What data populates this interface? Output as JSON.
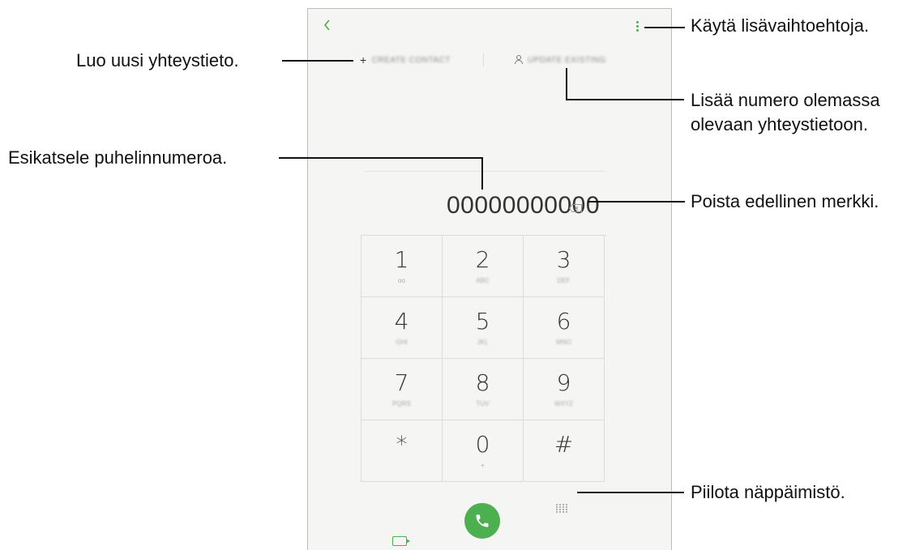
{
  "annotations": {
    "more_options": "Käytä lisävaihtoehtoja.",
    "create_contact": "Luo uusi yhteystieto.",
    "add_to_existing_1": "Lisää numero olemassa",
    "add_to_existing_2": "olevaan yhteystietoon.",
    "preview_number": "Esikatsele puhelinnumeroa.",
    "delete_char": "Poista edellinen merkki.",
    "hide_keypad": "Piilota näppäimistö."
  },
  "actions": {
    "create_contact": "CREATE CONTACT",
    "update_existing": "UPDATE EXISTING"
  },
  "dialer": {
    "number": "00000000000"
  },
  "keypad": [
    {
      "digit": "1",
      "sub": "oo"
    },
    {
      "digit": "2",
      "sub": "ABC"
    },
    {
      "digit": "3",
      "sub": "DEF"
    },
    {
      "digit": "4",
      "sub": "GHI"
    },
    {
      "digit": "5",
      "sub": "JKL"
    },
    {
      "digit": "6",
      "sub": "MNO"
    },
    {
      "digit": "7",
      "sub": "PQRS"
    },
    {
      "digit": "8",
      "sub": "TUV"
    },
    {
      "digit": "9",
      "sub": "WXYZ"
    },
    {
      "digit": "*",
      "sub": ""
    },
    {
      "digit": "0",
      "sub": "+"
    },
    {
      "digit": "#",
      "sub": ""
    }
  ],
  "icons": {
    "back": "chevron-left-icon",
    "more": "more-vert-icon",
    "person": "person-icon",
    "backspace": "backspace-icon",
    "video": "video-call-icon",
    "call": "phone-icon",
    "dialpad": "dialpad-icon"
  },
  "colors": {
    "accent": "#4caf50",
    "background": "#f5f5f3"
  }
}
